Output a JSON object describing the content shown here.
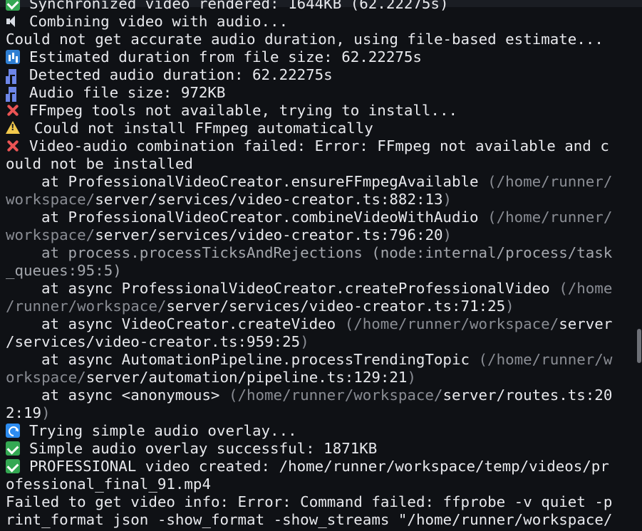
{
  "window": {
    "scrollbar": "scrollbar"
  },
  "terminal": {
    "lines": [
      {
        "icon": "check-icon",
        "text": "Synchronized video rendered: 1644KB (62.22275s)"
      },
      {
        "icon": "speaker-icon",
        "text": "Combining video with audio..."
      },
      {
        "text": "Could not get accurate audio duration, using file-based estimate..."
      },
      {
        "icon": "chart-icon",
        "text": "Estimated duration from file size: 62.22275s"
      },
      {
        "icon": "music-note-icon",
        "text": "Detected audio duration: 62.22275s"
      },
      {
        "icon": "music-note-icon",
        "text": "Audio file size: 972KB"
      },
      {
        "icon": "cross-icon",
        "text": "FFmpeg tools not available, trying to install..."
      },
      {
        "icon": "warning-icon",
        "text": "Could not install FFmpeg automatically"
      },
      {
        "icon": "cross-icon",
        "text": "Video-audio combination failed: Error: FFmpeg not available and c"
      },
      {
        "text": "ould not be installed"
      },
      {
        "indent": true,
        "text": "at ProfessionalVideoCreator.ensureFFmpegAvailable",
        "dim": "(/home/runner/"
      },
      {
        "dimStart": "workspace/",
        "text": "server/services/video-creator.ts:882:13",
        "tail": ")"
      },
      {
        "indent": true,
        "text": "at ProfessionalVideoCreator.combineVideoWithAudio",
        "dim": "(/home/runner/"
      },
      {
        "dimStart": "workspace/",
        "text": "server/services/video-creator.ts:796:20",
        "tail": ")"
      },
      {
        "indent": true,
        "muted": "at process.processTicksAndRejections (node:internal/process/task"
      },
      {
        "muted": "_queues:95:5)"
      },
      {
        "indent": true,
        "text": "at async ProfessionalVideoCreator.createProfessionalVideo",
        "dim": "(/home"
      },
      {
        "dimStart": "/runner/workspace/",
        "text": "server/services/video-creator.ts:71:25",
        "tail": ")"
      },
      {
        "indent": true,
        "text": "at async VideoCreator.createVideo",
        "dim": "(/home/runner/workspace/",
        "textEnd": "server"
      },
      {
        "text": "/services/video-creator.ts:959:25",
        "tail": ")"
      },
      {
        "indent": true,
        "text": "at async AutomationPipeline.processTrendingTopic",
        "dim": "(/home/runner/w"
      },
      {
        "dimStart": "orkspace/",
        "text": "server/automation/pipeline.ts:129:21",
        "tail": ")"
      },
      {
        "indent": true,
        "text": "at async <anonymous>",
        "dim": "(/home/runner/workspace/",
        "textEnd": "server/routes.ts:20"
      },
      {
        "text": "2:19",
        "tail": ")"
      },
      {
        "icon": "refresh-icon",
        "text": "Trying simple audio overlay..."
      },
      {
        "icon": "check-icon",
        "text": "Simple audio overlay successful: 1871KB"
      },
      {
        "icon": "check-icon",
        "text": "PROFESSIONAL video created: /home/runner/workspace/temp/videos/pr"
      },
      {
        "text": "ofessional_final_91.mp4"
      },
      {
        "text": "Failed to get video info: Error: Command failed: ffprobe -v quiet -p"
      },
      {
        "text": "rint_format json -show_format -show_streams \"/home/runner/workspace/"
      }
    ]
  },
  "colors": {
    "background": "#0f1115",
    "text": "#e8e9ed",
    "dim_text": "#8a8d94",
    "muted_text": "#a4a7ad",
    "success": "#34a853",
    "error": "#ea5454",
    "warning": "#f2c94c",
    "info": "#2d8cf0"
  }
}
